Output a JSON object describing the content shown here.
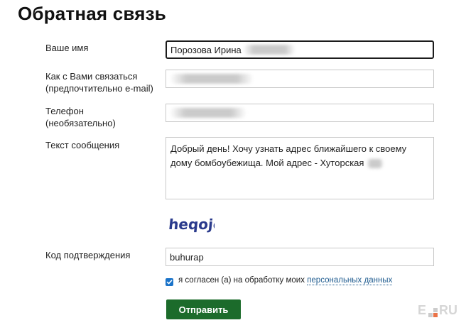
{
  "page_title": "Обратная связь",
  "form": {
    "name": {
      "label": "Ваше имя",
      "value": "Порозова Ирина"
    },
    "contact": {
      "label_line1": "Как с Вами связаться",
      "label_line2": "(предпочтительно e-mail)",
      "value": ""
    },
    "phone": {
      "label_line1": "Телефон",
      "label_line2": "(необязательно)",
      "value": ""
    },
    "message": {
      "label": "Текст сообщения",
      "value": "Добрый день! Хочу узнать адрес ближайшего к своему дому бомбоубежища. Мой адрес - Хуторская"
    },
    "captcha": {
      "image_text": "heqojc"
    },
    "confirmation": {
      "label": "Код подтверждения",
      "value": "buhurap"
    },
    "consent": {
      "checked": true,
      "text": "я согласен (а) на обработку моих",
      "link_text": "персональных данных"
    },
    "submit_label": "Отправить"
  },
  "watermark": {
    "text_left": "E",
    "text_right": "RU"
  },
  "colors": {
    "submit_bg": "#1c6b2b",
    "checkbox": "#1a73c9",
    "link": "#1e5b8f",
    "captcha": "#2a3a8c"
  }
}
